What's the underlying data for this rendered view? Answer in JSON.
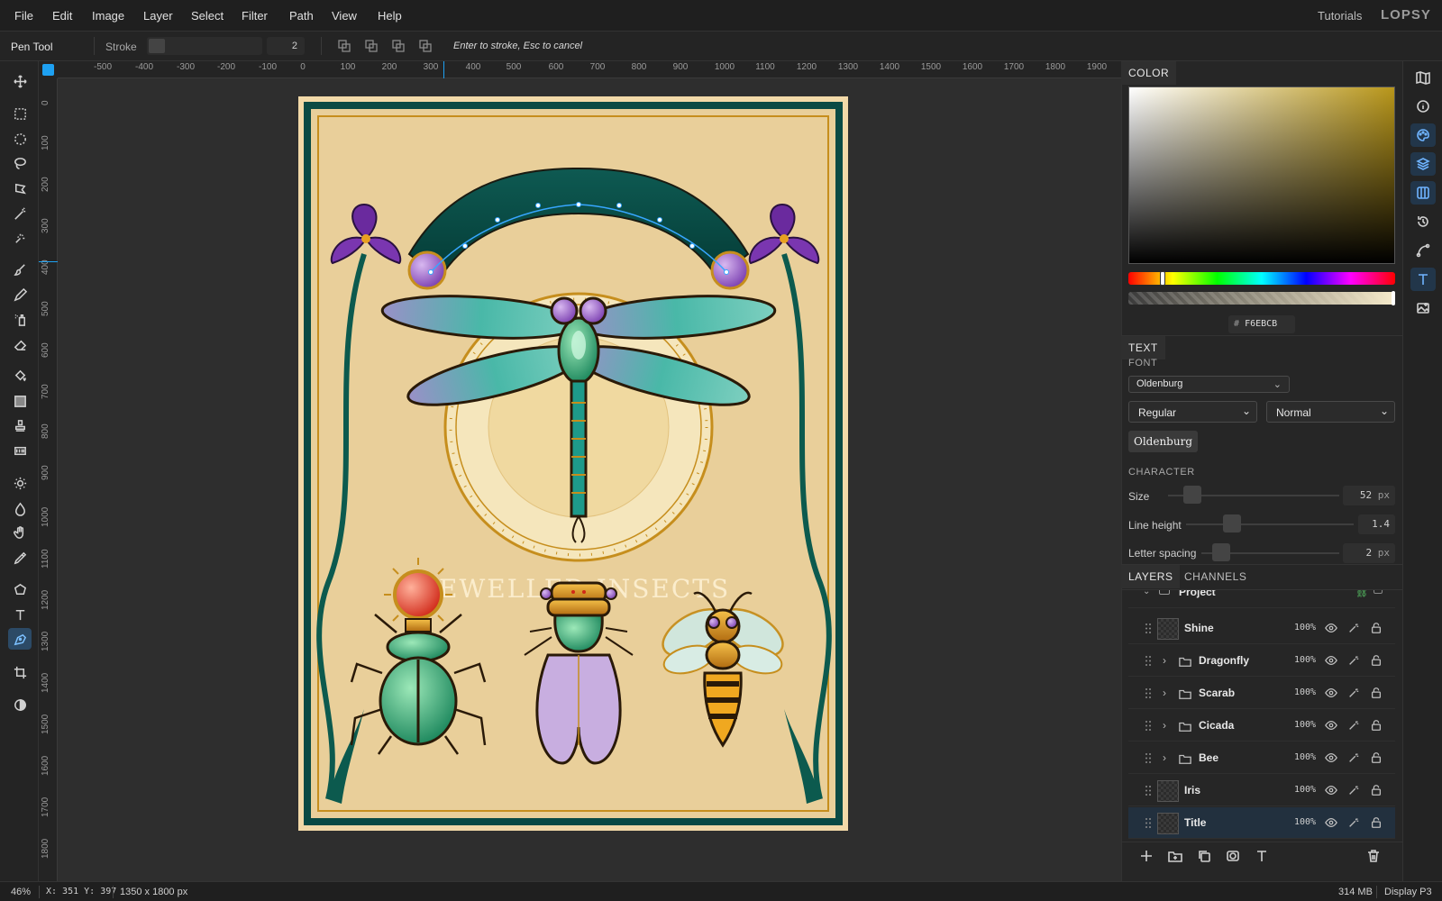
{
  "menu": [
    "File",
    "Edit",
    "Image",
    "Layer",
    "Select",
    "Filter",
    "Path",
    "View",
    "Help"
  ],
  "menu_right": {
    "tutorials": "Tutorials",
    "brand": "LOPSY"
  },
  "options": {
    "tool_name": "Pen Tool",
    "stroke_label": "Stroke",
    "stroke_value": "2",
    "hint": "Enter to stroke, Esc to cancel"
  },
  "ruler_top": [
    "-500",
    "-400",
    "-300",
    "-200",
    "-100",
    "0",
    "100",
    "200",
    "300",
    "400",
    "500",
    "600",
    "700",
    "800",
    "900",
    "1000",
    "1100",
    "1200",
    "1300",
    "1400",
    "1500",
    "1600",
    "1700",
    "1800",
    "1900"
  ],
  "ruler_left": [
    "0",
    "100",
    "200",
    "300",
    "400",
    "500",
    "600",
    "700",
    "800",
    "900",
    "1000",
    "1100",
    "1200",
    "1300",
    "1400",
    "1500",
    "1600",
    "1700",
    "1800"
  ],
  "artwork_title": "JEWELLED INSECTS",
  "color_panel": {
    "tab": "COLOR",
    "hex_prefix": "#",
    "hex": "F6EBCB",
    "accent": "#b8961a"
  },
  "text_panel": {
    "tab": "TEXT",
    "font_label": "FONT",
    "font": "Oldenburg",
    "weight": "Regular",
    "style": "Normal",
    "preview": "Oldenburg",
    "character_label": "CHARACTER",
    "size_label": "Size",
    "size_value": "52",
    "size_unit": "px",
    "line_height_label": "Line height",
    "line_height_value": "1.4",
    "letter_spacing_label": "Letter spacing",
    "letter_spacing_value": "2",
    "letter_spacing_unit": "px"
  },
  "layers_panel": {
    "tabs": [
      "LAYERS",
      "CHANNELS"
    ],
    "root": "Project",
    "layers": [
      {
        "name": "Shine",
        "opacity": "100%",
        "type": "layer"
      },
      {
        "name": "Dragonfly",
        "opacity": "100%",
        "type": "group"
      },
      {
        "name": "Scarab",
        "opacity": "100%",
        "type": "group"
      },
      {
        "name": "Cicada",
        "opacity": "100%",
        "type": "group"
      },
      {
        "name": "Bee",
        "opacity": "100%",
        "type": "group"
      },
      {
        "name": "Iris",
        "opacity": "100%",
        "type": "layer"
      },
      {
        "name": "Title",
        "opacity": "100%",
        "type": "layer",
        "selected": true
      }
    ]
  },
  "status": {
    "zoom": "46%",
    "coords": "X: 351 Y: 397",
    "doc_size": "1350 x 1800 px",
    "memory": "314 MB",
    "profile": "Display P3"
  }
}
